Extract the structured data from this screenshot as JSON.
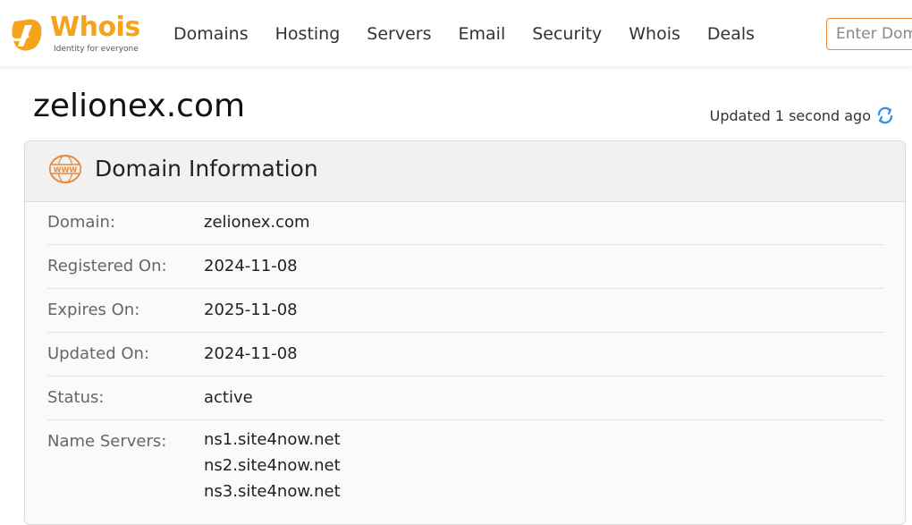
{
  "logo": {
    "name": "Whois",
    "tagline": "Identity for everyone"
  },
  "nav": {
    "items": [
      "Domains",
      "Hosting",
      "Servers",
      "Email",
      "Security",
      "Whois",
      "Deals"
    ]
  },
  "search": {
    "placeholder": "Enter Domain"
  },
  "page": {
    "title": "zelionex.com",
    "updated_text": "Updated 1 second ago"
  },
  "card": {
    "title": "Domain Information",
    "icon": "www-icon",
    "rows": [
      {
        "label": "Domain:",
        "value": "zelionex.com"
      },
      {
        "label": "Registered On:",
        "value": "2024-11-08"
      },
      {
        "label": "Expires On:",
        "value": "2025-11-08"
      },
      {
        "label": "Updated On:",
        "value": "2024-11-08"
      },
      {
        "label": "Status:",
        "value": "active"
      }
    ],
    "name_servers_label": "Name Servers:",
    "name_servers": [
      "ns1.site4now.net",
      "ns2.site4now.net",
      "ns3.site4now.net"
    ]
  },
  "colors": {
    "brand_orange": "#f5a31a",
    "accent_orange": "#e8893a",
    "refresh_blue": "#3a8ee6"
  }
}
